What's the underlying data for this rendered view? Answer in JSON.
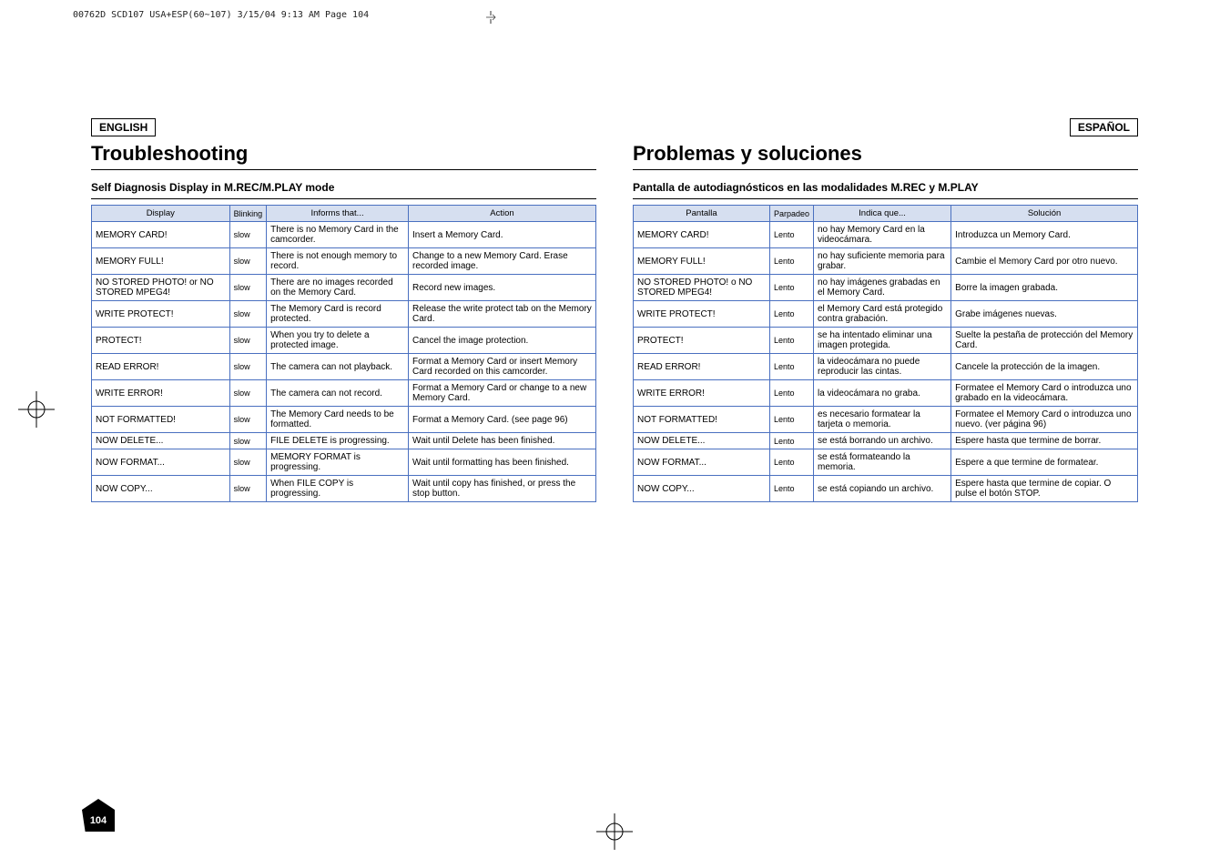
{
  "header_line": "00762D SCD107 USA+ESP(60~107)  3/15/04 9:13 AM  Page 104",
  "page_number": "104",
  "left": {
    "lang": "ENGLISH",
    "title": "Troubleshooting",
    "subtitle": "Self Diagnosis Display in M.REC/M.PLAY mode",
    "headers": [
      "Display",
      "Blinking",
      "Informs that...",
      "Action"
    ],
    "rows": [
      [
        "MEMORY CARD!",
        "slow",
        "There is no Memory Card in the camcorder.",
        "Insert a Memory Card."
      ],
      [
        "MEMORY FULL!",
        "slow",
        "There is not enough memory to record.",
        "Change to a new Memory Card. Erase recorded image."
      ],
      [
        "NO STORED PHOTO! or NO STORED MPEG4!",
        "slow",
        "There are no images recorded on the Memory Card.",
        "Record new images."
      ],
      [
        "WRITE PROTECT!",
        "slow",
        "The Memory Card is record protected.",
        "Release the write protect tab on the Memory Card."
      ],
      [
        "PROTECT!",
        "slow",
        "When you try to delete a protected image.",
        "Cancel the image protection."
      ],
      [
        "READ ERROR!",
        "slow",
        "The camera can not playback.",
        "Format a Memory Card or insert Memory Card recorded on this camcorder."
      ],
      [
        "WRITE ERROR!",
        "slow",
        "The camera can not record.",
        "Format a Memory Card or change to a new Memory Card."
      ],
      [
        "NOT FORMATTED!",
        "slow",
        "The Memory Card needs to be formatted.",
        "Format a Memory Card. (see page 96)"
      ],
      [
        "NOW DELETE...",
        "slow",
        "FILE DELETE is progressing.",
        "Wait until Delete has been finished."
      ],
      [
        "NOW FORMAT...",
        "slow",
        "MEMORY FORMAT is progressing.",
        "Wait until formatting has been finished."
      ],
      [
        "NOW COPY...",
        "slow",
        "When FILE COPY is progressing.",
        "Wait until copy has finished, or press the stop button."
      ]
    ]
  },
  "right": {
    "lang": "ESPAÑOL",
    "title": "Problemas y soluciones",
    "subtitle": "Pantalla de autodiagnósticos en las modalidades M.REC y M.PLAY",
    "headers": [
      "Pantalla",
      "Parpadeo",
      "Indica que...",
      "Solución"
    ],
    "rows": [
      [
        "MEMORY CARD!",
        "Lento",
        "no hay Memory Card en la videocámara.",
        "Introduzca un Memory Card."
      ],
      [
        "MEMORY FULL!",
        "Lento",
        "no hay suficiente memoria para grabar.",
        "Cambie el Memory Card por otro nuevo."
      ],
      [
        "NO STORED PHOTO! o NO STORED MPEG4!",
        "Lento",
        "no hay imágenes grabadas en el Memory Card.",
        "Borre la imagen grabada."
      ],
      [
        "WRITE PROTECT!",
        "Lento",
        "el Memory Card está protegido contra grabación.",
        "Grabe imágenes nuevas."
      ],
      [
        "PROTECT!",
        "Lento",
        "se ha intentado eliminar una imagen protegida.",
        "Suelte la pestaña de protección del Memory Card."
      ],
      [
        "READ ERROR!",
        "Lento",
        "la videocámara no puede reproducir las cintas.",
        "Cancele la protección de la imagen."
      ],
      [
        "WRITE ERROR!",
        "Lento",
        "la videocámara no graba.",
        "Formatee el Memory Card o introduzca uno grabado en la videocámara."
      ],
      [
        "NOT FORMATTED!",
        "Lento",
        "es necesario formatear la tarjeta o memoria.",
        "Formatee el Memory Card o introduzca uno nuevo. (ver página 96)"
      ],
      [
        "NOW DELETE...",
        "Lento",
        "se está borrando un archivo.",
        "Espere hasta que termine de borrar."
      ],
      [
        "NOW FORMAT...",
        "Lento",
        "se está formateando la memoria.",
        "Espere a que termine de formatear."
      ],
      [
        "NOW COPY...",
        "Lento",
        "se está copiando un archivo.",
        "Espere hasta que termine de copiar. O pulse el botón STOP."
      ]
    ]
  }
}
